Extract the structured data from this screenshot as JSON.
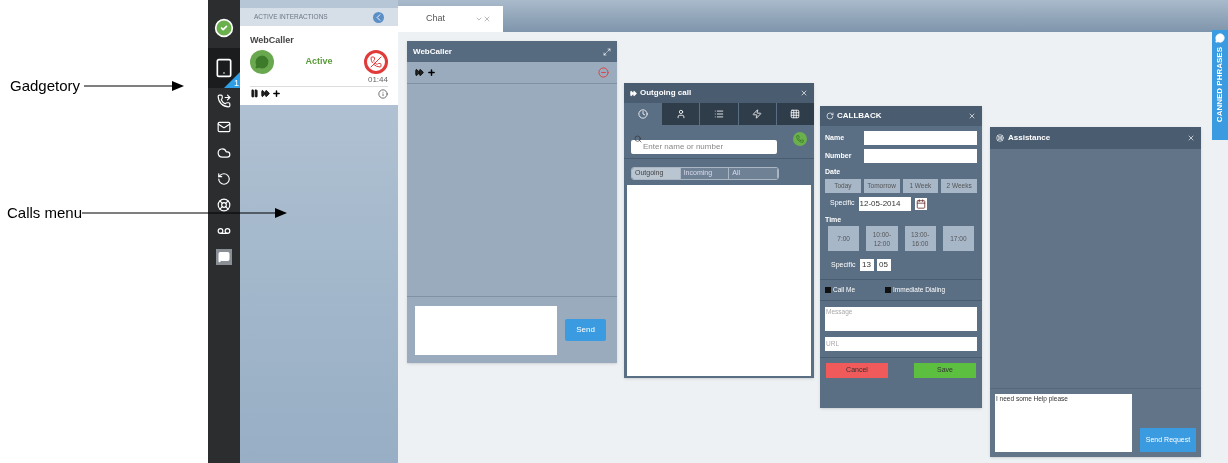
{
  "annotations": [
    {
      "label": "Gadgetory"
    },
    {
      "label": "Calls menu"
    }
  ],
  "sidebar": {
    "items": [
      {
        "selected": false
      },
      {
        "selected": true,
        "badge": "1"
      },
      {
        "selected": false
      },
      {
        "selected": false
      },
      {
        "selected": false
      },
      {
        "selected": false
      },
      {
        "selected": false
      },
      {
        "selected": false
      },
      {
        "selected": false
      }
    ]
  },
  "interactions": {
    "header": "ACTIVE INTERACTIONS",
    "card": {
      "name": "WebCaller",
      "status": "Active",
      "timer": "01:44"
    }
  },
  "tabs": [
    {
      "label": "Chat",
      "selected": true
    }
  ],
  "canned_phrases": "CANNED PHRASES",
  "webcaller": {
    "title": "WebCaller",
    "send": "Send"
  },
  "outgoing_call": {
    "title": "Outgoing call",
    "tabs": [
      {
        "selected": true
      },
      {
        "selected": false
      },
      {
        "selected": false
      },
      {
        "selected": false
      },
      {
        "selected": false
      }
    ],
    "search": {
      "placeholder": "Enter name or number"
    },
    "filters": [
      {
        "label": "Outgoing",
        "selected": true
      },
      {
        "label": "Incoming",
        "selected": false
      },
      {
        "label": "All",
        "selected": false
      }
    ]
  },
  "callback": {
    "title": "CALLBACK",
    "fields": [
      {
        "label": "Name"
      },
      {
        "label": "Number"
      }
    ],
    "date_label": "Date",
    "date_options": [
      "Today",
      "Tomorrow",
      "1 Week",
      "2 Weeks"
    ],
    "specific_date_label": "Specific",
    "specific_date": "12-05-2014",
    "time_label": "Time",
    "time_options": [
      "7:00",
      "10:00-12:00",
      "13:00-16:00",
      "17:00"
    ],
    "specific_time_label": "Specific",
    "hour": "13",
    "minute": "05",
    "checks": [
      {
        "label": "Call Me",
        "checked": false
      },
      {
        "label": "Immediate Dialing",
        "checked": false
      }
    ],
    "message": {
      "placeholder": "Message"
    },
    "url": {
      "placeholder": "URL"
    },
    "cancel": "Cancel",
    "save": "Save"
  },
  "assistance": {
    "title": "Assistance",
    "message": "I need some Help please",
    "send": "Send Request"
  }
}
